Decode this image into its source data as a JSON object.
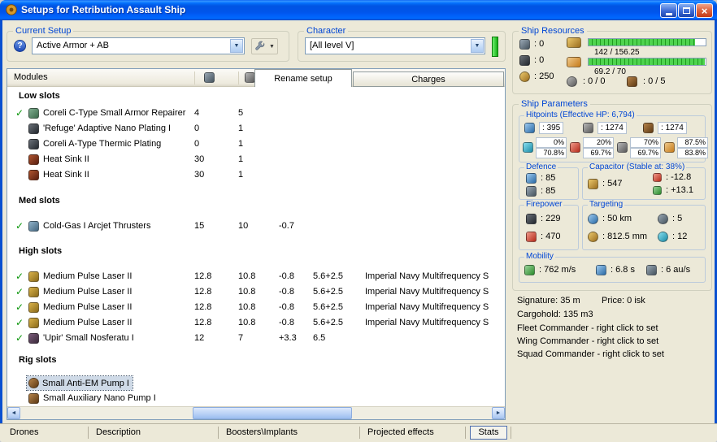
{
  "icons": {
    "check": "✓",
    "help": "?",
    "combo_arrow": "▼",
    "menu_arrow": "▼",
    "scroll_left": "◄",
    "scroll_right": "►",
    "close": "×"
  },
  "window": {
    "title": "Setups for Retribution Assault Ship"
  },
  "current_setup": {
    "label": "Current Setup",
    "value": "Active Armor + AB"
  },
  "character": {
    "label": "Character",
    "value": "[All level V]"
  },
  "ship_resources": {
    "label": "Ship Resources",
    "turrets": "0",
    "launchers": "0",
    "calibration": "250",
    "cpu": {
      "text": "142 / 156.25",
      "percent": 91
    },
    "powergrid": {
      "text": "69.2 / 70",
      "percent": 99
    },
    "drones": "0 / 0",
    "upgrades": "0 / 5"
  },
  "modules_panel": {
    "column_header": "Modules",
    "tabs": [
      {
        "label": "Rename setup"
      },
      {
        "label": "Charges"
      }
    ],
    "sections": [
      {
        "title": "Low slots",
        "rows": [
          {
            "name": "Coreli C-Type Small Armor Repairer",
            "c1": "4",
            "c2": "5"
          },
          {
            "name": "'Refuge' Adaptive Nano Plating I",
            "c1": "0",
            "c2": "1"
          },
          {
            "name": "Coreli A-Type Thermic Plating",
            "c1": "0",
            "c2": "1"
          },
          {
            "name": "Heat Sink II",
            "c1": "30",
            "c2": "1"
          },
          {
            "name": "Heat Sink II",
            "c1": "30",
            "c2": "1"
          }
        ]
      },
      {
        "title": "Med slots",
        "rows": [
          {
            "name": "Cold-Gas I Arcjet Thrusters",
            "c1": "15",
            "c2": "10",
            "c3": "-0.7"
          }
        ]
      },
      {
        "title": "High slots",
        "rows": [
          {
            "name": "Medium Pulse Laser II",
            "c1": "12.8",
            "c2": "10.8",
            "c3": "-0.8",
            "c4": "5.6+2.5",
            "charge": "Imperial Navy Multifrequency S"
          },
          {
            "name": "Medium Pulse Laser II",
            "c1": "12.8",
            "c2": "10.8",
            "c3": "-0.8",
            "c4": "5.6+2.5",
            "charge": "Imperial Navy Multifrequency S"
          },
          {
            "name": "Medium Pulse Laser II",
            "c1": "12.8",
            "c2": "10.8",
            "c3": "-0.8",
            "c4": "5.6+2.5",
            "charge": "Imperial Navy Multifrequency S"
          },
          {
            "name": "Medium Pulse Laser II",
            "c1": "12.8",
            "c2": "10.8",
            "c3": "-0.8",
            "c4": "5.6+2.5",
            "charge": "Imperial Navy Multifrequency S"
          },
          {
            "name": "'Upir' Small Nosferatu I",
            "c1": "12",
            "c2": "7",
            "c3": "+3.3",
            "c4": "6.5"
          }
        ]
      },
      {
        "title": "Rig slots",
        "rows": [
          {
            "name": "Small Anti-EM Pump I"
          },
          {
            "name": "Small Auxiliary Nano Pump I"
          }
        ]
      }
    ]
  },
  "bottom_tabs": [
    {
      "label": "Drones"
    },
    {
      "label": "Description"
    },
    {
      "label": "Boosters\\Implants"
    },
    {
      "label": "Projected effects"
    },
    {
      "label": "Stats"
    }
  ],
  "ship_parameters": {
    "label": "Ship Parameters",
    "hitpoints": {
      "label": "Hitpoints (Effective HP: 6,794)",
      "shield": "395",
      "armor": "1274",
      "structure": "1274",
      "resists": [
        {
          "name": "em",
          "shield": "0%",
          "armor": "70.8%"
        },
        {
          "name": "thermal",
          "shield": "20%",
          "armor": "69.7%"
        },
        {
          "name": "kinetic",
          "shield": "70%",
          "armor": "69.7%"
        },
        {
          "name": "explosive",
          "shield": "87.5%",
          "armor": "83.8%"
        }
      ]
    },
    "defence": {
      "label": "Defence",
      "value_top": "85",
      "value_bottom": "85"
    },
    "capacitor": {
      "label": "Capacitor (Stable at: 38%)",
      "capacity": "547",
      "usage": "-12.8",
      "recharge": "+13.1"
    },
    "firepower": {
      "label": "Firepower",
      "volley": "229",
      "dps": "470"
    },
    "targeting": {
      "label": "Targeting",
      "range": "50 km",
      "max_targets": "5",
      "scan_resolution": "812.5 mm",
      "sensor_strength": "12"
    },
    "mobility": {
      "label": "Mobility",
      "speed": "762 m/s",
      "align_time": "6.8 s",
      "warp_speed": "6 au/s"
    },
    "signature": "Signature: 35 m",
    "price": "Price: 0 isk",
    "cargohold": "Cargohold: 135 m3",
    "fleet_commander": "Fleet Commander - right click to set",
    "wing_commander": "Wing Commander - right click to set",
    "squad_commander": "Squad Commander - right click to set"
  }
}
